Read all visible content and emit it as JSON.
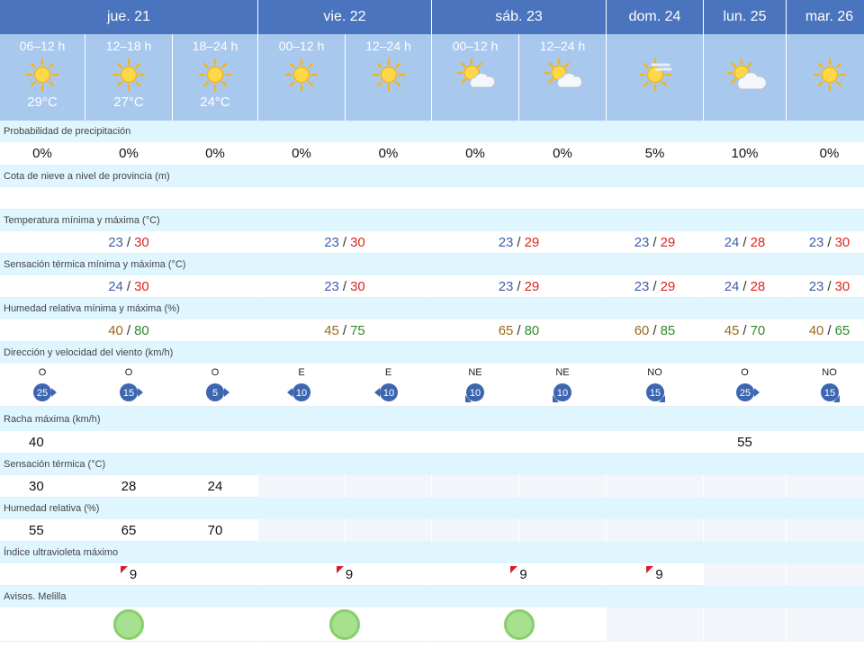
{
  "colors": {
    "day_header_bg": "#4a74bd",
    "period_header_bg": "#a9c8ee",
    "label_row_bg": "#dff6ff",
    "temp_min": "#3f5fa6",
    "temp_max": "#d8261f",
    "humidity_min": "#9a6a1f",
    "humidity_max": "#2f8a2f",
    "wind_badge": "#3d66b0",
    "uv_flag": "#d81e2a",
    "alert_green": "#a7e08e"
  },
  "days": [
    {
      "label": "jue. 21",
      "span": 3
    },
    {
      "label": "vie. 22",
      "span": 2
    },
    {
      "label": "sáb. 23",
      "span": 2
    },
    {
      "label": "dom. 24",
      "span": 1
    },
    {
      "label": "lun. 25",
      "span": 1
    },
    {
      "label": "mar. 26",
      "span": 1
    }
  ],
  "periods": [
    {
      "time": "06–12 h",
      "icon": "sun-icon",
      "temp": "29°C"
    },
    {
      "time": "12–18 h",
      "icon": "sun-icon",
      "temp": "27°C"
    },
    {
      "time": "18–24 h",
      "icon": "sun-icon",
      "temp": "24°C"
    },
    {
      "time": "00–12 h",
      "icon": "sun-icon",
      "temp": ""
    },
    {
      "time": "12–24 h",
      "icon": "sun-icon",
      "temp": ""
    },
    {
      "time": "00–12 h",
      "icon": "sun-cloud-icon",
      "temp": ""
    },
    {
      "time": "12–24 h",
      "icon": "sun-cloud-icon",
      "temp": ""
    },
    {
      "time": "",
      "icon": "sun-haze-icon",
      "temp": ""
    },
    {
      "time": "",
      "icon": "sun-cloud-icon",
      "temp": ""
    },
    {
      "time": "",
      "icon": "sun-icon",
      "temp": ""
    }
  ],
  "labels": {
    "precip": "Probabilidad de precipitación",
    "snow": "Cota de nieve a nivel de provincia (m)",
    "temp": "Temperatura mínima y máxima (°C)",
    "feels": "Sensación térmica mínima y máxima (°C)",
    "humidity": "Humedad relativa mínima y máxima (%)",
    "wind": "Dirección y velocidad del viento (km/h)",
    "gust": "Racha máxima (km/h)",
    "feels_period": "Sensación térmica (°C)",
    "humidity_period": "Humedad relativa (%)",
    "uv": "Índice ultravioleta máximo",
    "alerts": "Avisos. Melilla"
  },
  "precip": [
    "0%",
    "0%",
    "0%",
    "0%",
    "0%",
    "0%",
    "0%",
    "5%",
    "10%",
    "0%"
  ],
  "temp_minmax": [
    {
      "min": "23",
      "max": "30"
    },
    {
      "min": "23",
      "max": "30"
    },
    {
      "min": "23",
      "max": "29"
    },
    {
      "min": "23",
      "max": "29"
    },
    {
      "min": "24",
      "max": "28"
    },
    {
      "min": "23",
      "max": "30"
    }
  ],
  "feels_minmax": [
    {
      "min": "24",
      "max": "30"
    },
    {
      "min": "23",
      "max": "30"
    },
    {
      "min": "23",
      "max": "29"
    },
    {
      "min": "23",
      "max": "29"
    },
    {
      "min": "24",
      "max": "28"
    },
    {
      "min": "23",
      "max": "30"
    }
  ],
  "humidity_minmax": [
    {
      "min": "40",
      "max": "80"
    },
    {
      "min": "45",
      "max": "75"
    },
    {
      "min": "65",
      "max": "80"
    },
    {
      "min": "60",
      "max": "85"
    },
    {
      "min": "45",
      "max": "70"
    },
    {
      "min": "40",
      "max": "65"
    }
  ],
  "wind": [
    {
      "dir": "O",
      "speed": "25"
    },
    {
      "dir": "O",
      "speed": "15"
    },
    {
      "dir": "O",
      "speed": "5"
    },
    {
      "dir": "E",
      "speed": "10"
    },
    {
      "dir": "E",
      "speed": "10"
    },
    {
      "dir": "NE",
      "speed": "10"
    },
    {
      "dir": "NE",
      "speed": "10"
    },
    {
      "dir": "NO",
      "speed": "15"
    },
    {
      "dir": "O",
      "speed": "25"
    },
    {
      "dir": "NO",
      "speed": "15"
    }
  ],
  "gust": [
    "40",
    "",
    "",
    "",
    "",
    "",
    "",
    "",
    "55",
    ""
  ],
  "feels_period": [
    "30",
    "28",
    "24"
  ],
  "humidity_period": [
    "55",
    "65",
    "70"
  ],
  "uv": [
    "9",
    "9",
    "9",
    "9"
  ]
}
